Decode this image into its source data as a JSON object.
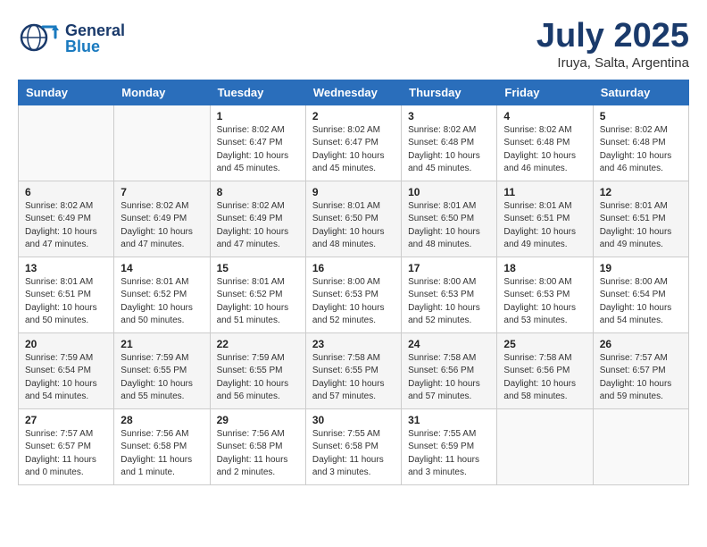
{
  "header": {
    "logo_general": "General",
    "logo_blue": "Blue",
    "month_year": "July 2025",
    "location": "Iruya, Salta, Argentina"
  },
  "weekdays": [
    "Sunday",
    "Monday",
    "Tuesday",
    "Wednesday",
    "Thursday",
    "Friday",
    "Saturday"
  ],
  "weeks": [
    [
      {
        "day": "",
        "info": ""
      },
      {
        "day": "",
        "info": ""
      },
      {
        "day": "1",
        "info": "Sunrise: 8:02 AM\nSunset: 6:47 PM\nDaylight: 10 hours and 45 minutes."
      },
      {
        "day": "2",
        "info": "Sunrise: 8:02 AM\nSunset: 6:47 PM\nDaylight: 10 hours and 45 minutes."
      },
      {
        "day": "3",
        "info": "Sunrise: 8:02 AM\nSunset: 6:48 PM\nDaylight: 10 hours and 45 minutes."
      },
      {
        "day": "4",
        "info": "Sunrise: 8:02 AM\nSunset: 6:48 PM\nDaylight: 10 hours and 46 minutes."
      },
      {
        "day": "5",
        "info": "Sunrise: 8:02 AM\nSunset: 6:48 PM\nDaylight: 10 hours and 46 minutes."
      }
    ],
    [
      {
        "day": "6",
        "info": "Sunrise: 8:02 AM\nSunset: 6:49 PM\nDaylight: 10 hours and 47 minutes."
      },
      {
        "day": "7",
        "info": "Sunrise: 8:02 AM\nSunset: 6:49 PM\nDaylight: 10 hours and 47 minutes."
      },
      {
        "day": "8",
        "info": "Sunrise: 8:02 AM\nSunset: 6:49 PM\nDaylight: 10 hours and 47 minutes."
      },
      {
        "day": "9",
        "info": "Sunrise: 8:01 AM\nSunset: 6:50 PM\nDaylight: 10 hours and 48 minutes."
      },
      {
        "day": "10",
        "info": "Sunrise: 8:01 AM\nSunset: 6:50 PM\nDaylight: 10 hours and 48 minutes."
      },
      {
        "day": "11",
        "info": "Sunrise: 8:01 AM\nSunset: 6:51 PM\nDaylight: 10 hours and 49 minutes."
      },
      {
        "day": "12",
        "info": "Sunrise: 8:01 AM\nSunset: 6:51 PM\nDaylight: 10 hours and 49 minutes."
      }
    ],
    [
      {
        "day": "13",
        "info": "Sunrise: 8:01 AM\nSunset: 6:51 PM\nDaylight: 10 hours and 50 minutes."
      },
      {
        "day": "14",
        "info": "Sunrise: 8:01 AM\nSunset: 6:52 PM\nDaylight: 10 hours and 50 minutes."
      },
      {
        "day": "15",
        "info": "Sunrise: 8:01 AM\nSunset: 6:52 PM\nDaylight: 10 hours and 51 minutes."
      },
      {
        "day": "16",
        "info": "Sunrise: 8:00 AM\nSunset: 6:53 PM\nDaylight: 10 hours and 52 minutes."
      },
      {
        "day": "17",
        "info": "Sunrise: 8:00 AM\nSunset: 6:53 PM\nDaylight: 10 hours and 52 minutes."
      },
      {
        "day": "18",
        "info": "Sunrise: 8:00 AM\nSunset: 6:53 PM\nDaylight: 10 hours and 53 minutes."
      },
      {
        "day": "19",
        "info": "Sunrise: 8:00 AM\nSunset: 6:54 PM\nDaylight: 10 hours and 54 minutes."
      }
    ],
    [
      {
        "day": "20",
        "info": "Sunrise: 7:59 AM\nSunset: 6:54 PM\nDaylight: 10 hours and 54 minutes."
      },
      {
        "day": "21",
        "info": "Sunrise: 7:59 AM\nSunset: 6:55 PM\nDaylight: 10 hours and 55 minutes."
      },
      {
        "day": "22",
        "info": "Sunrise: 7:59 AM\nSunset: 6:55 PM\nDaylight: 10 hours and 56 minutes."
      },
      {
        "day": "23",
        "info": "Sunrise: 7:58 AM\nSunset: 6:55 PM\nDaylight: 10 hours and 57 minutes."
      },
      {
        "day": "24",
        "info": "Sunrise: 7:58 AM\nSunset: 6:56 PM\nDaylight: 10 hours and 57 minutes."
      },
      {
        "day": "25",
        "info": "Sunrise: 7:58 AM\nSunset: 6:56 PM\nDaylight: 10 hours and 58 minutes."
      },
      {
        "day": "26",
        "info": "Sunrise: 7:57 AM\nSunset: 6:57 PM\nDaylight: 10 hours and 59 minutes."
      }
    ],
    [
      {
        "day": "27",
        "info": "Sunrise: 7:57 AM\nSunset: 6:57 PM\nDaylight: 11 hours and 0 minutes."
      },
      {
        "day": "28",
        "info": "Sunrise: 7:56 AM\nSunset: 6:58 PM\nDaylight: 11 hours and 1 minute."
      },
      {
        "day": "29",
        "info": "Sunrise: 7:56 AM\nSunset: 6:58 PM\nDaylight: 11 hours and 2 minutes."
      },
      {
        "day": "30",
        "info": "Sunrise: 7:55 AM\nSunset: 6:58 PM\nDaylight: 11 hours and 3 minutes."
      },
      {
        "day": "31",
        "info": "Sunrise: 7:55 AM\nSunset: 6:59 PM\nDaylight: 11 hours and 3 minutes."
      },
      {
        "day": "",
        "info": ""
      },
      {
        "day": "",
        "info": ""
      }
    ]
  ]
}
